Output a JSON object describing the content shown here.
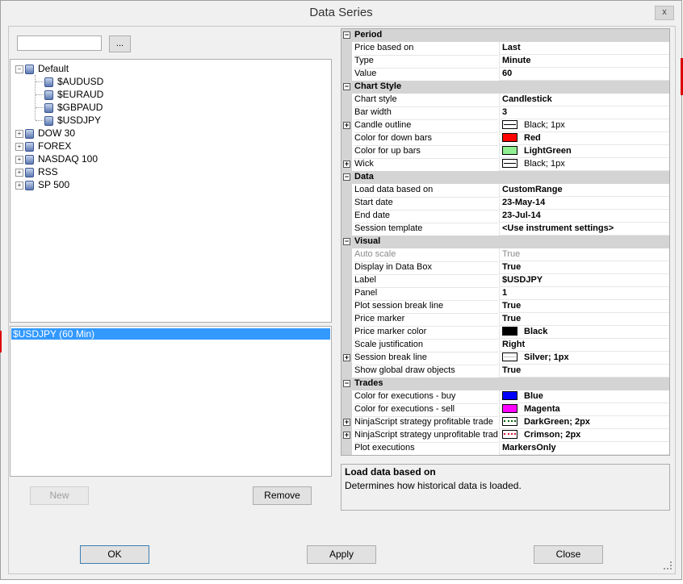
{
  "window": {
    "title": "Data Series",
    "close_label": "x"
  },
  "search": {
    "value": "",
    "browse_label": "..."
  },
  "tree": [
    {
      "label": "Default",
      "expanded": true,
      "children": [
        "$AUDUSD",
        "$EURAUD",
        "$GBPAUD",
        "$USDJPY"
      ]
    },
    {
      "label": "DOW 30",
      "expanded": false
    },
    {
      "label": "FOREX",
      "expanded": false
    },
    {
      "label": "NASDAQ 100",
      "expanded": false
    },
    {
      "label": "RSS",
      "expanded": false
    },
    {
      "label": "SP 500",
      "expanded": false
    }
  ],
  "series_list": {
    "items": [
      "$USDJPY (60 Min)"
    ]
  },
  "buttons": {
    "new": "New",
    "remove": "Remove",
    "ok": "OK",
    "apply": "Apply",
    "close": "Close"
  },
  "properties": [
    {
      "type": "cat",
      "label": "Period"
    },
    {
      "name": "Price based on",
      "value": "Last"
    },
    {
      "name": "Type",
      "value": "Minute"
    },
    {
      "name": "Value",
      "value": "60"
    },
    {
      "type": "cat",
      "label": "Chart Style"
    },
    {
      "name": "Chart style",
      "value": "Candlestick"
    },
    {
      "name": "Bar width",
      "value": "3"
    },
    {
      "name": "Candle outline",
      "value": "Black; 1px",
      "expandable": true,
      "line": "black",
      "normal": true
    },
    {
      "name": "Color for down bars",
      "value": "Red",
      "color": "#ff0000"
    },
    {
      "name": "Color for up bars",
      "value": "LightGreen",
      "color": "#90ee90"
    },
    {
      "name": "Wick",
      "value": "Black; 1px",
      "expandable": true,
      "line": "black",
      "normal": true
    },
    {
      "type": "cat",
      "label": "Data"
    },
    {
      "name": "Load data based on",
      "value": "CustomRange"
    },
    {
      "name": "Start date",
      "value": "23-May-14"
    },
    {
      "name": "End date",
      "value": "23-Jul-14"
    },
    {
      "name": "Session template",
      "value": "<Use instrument settings>"
    },
    {
      "type": "cat",
      "label": "Visual"
    },
    {
      "name": "Auto scale",
      "value": "True",
      "dim": true
    },
    {
      "name": "Display in Data Box",
      "value": "True"
    },
    {
      "name": "Label",
      "value": "$USDJPY"
    },
    {
      "name": "Panel",
      "value": "1"
    },
    {
      "name": "Plot session break line",
      "value": "True"
    },
    {
      "name": "Price marker",
      "value": "True"
    },
    {
      "name": "Price marker color",
      "value": "Black",
      "color": "#000000"
    },
    {
      "name": "Scale justification",
      "value": "Right"
    },
    {
      "name": "Session break line",
      "value": "Silver; 1px",
      "expandable": true,
      "line": "silver"
    },
    {
      "name": "Show global draw objects",
      "value": "True"
    },
    {
      "type": "cat",
      "label": "Trades"
    },
    {
      "name": "Color for executions - buy",
      "value": "Blue",
      "color": "#0000ff"
    },
    {
      "name": "Color for executions - sell",
      "value": "Magenta",
      "color": "#ff00ff"
    },
    {
      "name": "NinjaScript strategy profitable trade",
      "value": "DarkGreen; 2px",
      "expandable": true,
      "line": "dotgreen"
    },
    {
      "name": "NinjaScript strategy unprofitable trade",
      "value": "Crimson; 2px",
      "expandable": true,
      "line": "dotred"
    },
    {
      "name": "Plot executions",
      "value": "MarkersOnly"
    }
  ],
  "help": {
    "title": "Load data based on",
    "description": "Determines how historical data is loaded."
  }
}
